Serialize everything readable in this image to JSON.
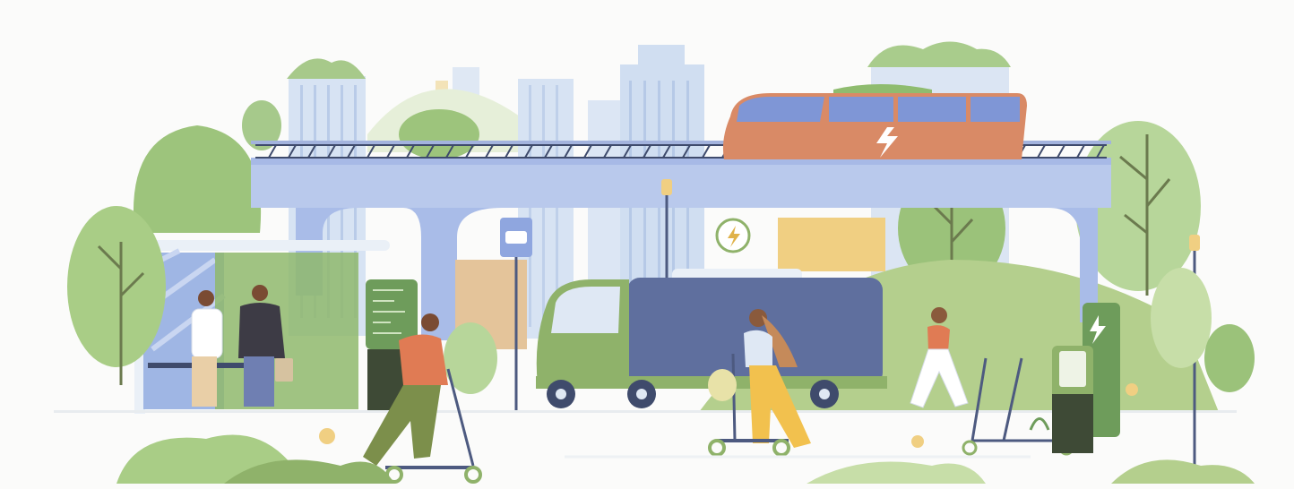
{
  "illustration": {
    "palette": {
      "background": "#fbfbfa",
      "sky_building": "#d7e3f3",
      "overpass": "#b9c9ec",
      "overpass_dark": "#9fb2e3",
      "tree_green": "#9bc27a",
      "tree_light": "#c7dea8",
      "hill_green": "#b4cf8d",
      "tram_orange": "#d98a66",
      "tram_window": "#7f96d6",
      "truck_blue": "#5f6f9e",
      "truck_green": "#8fb26a",
      "crate_yellow": "#f0cf82",
      "person_orange": "#e07b54",
      "pants_olive": "#7c8f4b",
      "pants_yellow": "#f2c14e",
      "station_green": "#6e9c5b"
    },
    "icons": [
      "bus-stop-sign-icon",
      "charging-bolt-icon",
      "street-lamp-icon",
      "charging-station-icon"
    ]
  }
}
